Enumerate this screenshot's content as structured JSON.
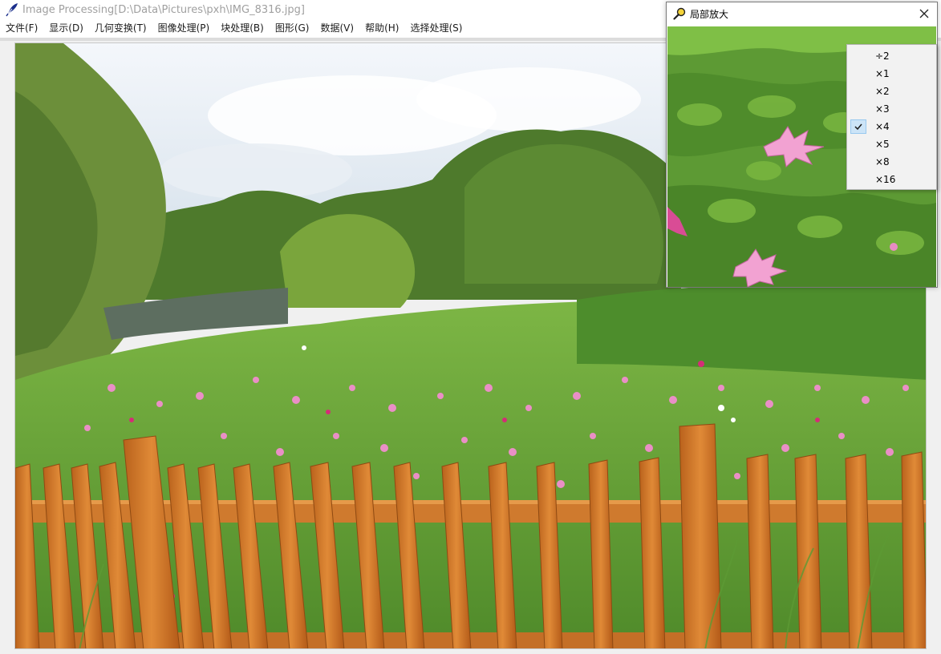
{
  "window": {
    "title": "Image Processing[D:\\Data\\Pictures\\pxh\\IMG_8316.jpg]"
  },
  "menu": [
    {
      "label": "文件(F)"
    },
    {
      "label": "显示(D)"
    },
    {
      "label": "几何变换(T)"
    },
    {
      "label": "图像处理(P)"
    },
    {
      "label": "块处理(B)"
    },
    {
      "label": "图形(G)"
    },
    {
      "label": "数据(V)"
    },
    {
      "label": "帮助(H)"
    },
    {
      "label": "选择处理(S)"
    }
  ],
  "magnifier": {
    "title": "局部放大",
    "close_icon": "close-icon",
    "zoom_options": [
      {
        "label": "÷2",
        "checked": false
      },
      {
        "label": "×1",
        "checked": false
      },
      {
        "label": "×2",
        "checked": false
      },
      {
        "label": "×3",
        "checked": false
      },
      {
        "label": "×4",
        "checked": true
      },
      {
        "label": "×5",
        "checked": false
      },
      {
        "label": "×8",
        "checked": false
      },
      {
        "label": "×16",
        "checked": false
      }
    ]
  },
  "colors": {
    "sky": "#dfe9f2",
    "grass": "#6ea83b",
    "fence": "#d97b2a",
    "flower": "#e88cc4",
    "check_highlight": "#cce4f7"
  }
}
